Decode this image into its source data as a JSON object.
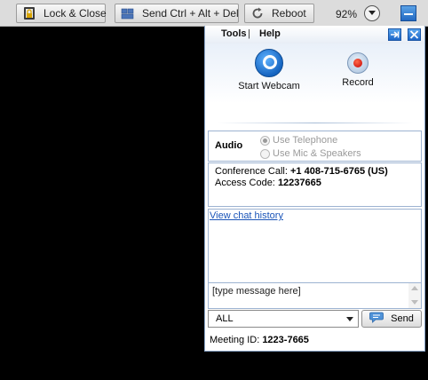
{
  "toolbar": {
    "lock_label": "Lock & Close",
    "cad_label": "Send Ctrl + Alt + Del",
    "reboot_label": "Reboot",
    "zoom": "92%",
    "icons": {
      "lock": "lock-icon",
      "cad": "keyboard-icon",
      "reboot": "reboot-icon",
      "zoom_dropdown": "chevron-down-icon",
      "minimize": "minimize-icon"
    }
  },
  "panel": {
    "menu": {
      "tools": "Tools",
      "separator": "|",
      "help": "Help"
    },
    "header_icons": {
      "popout": "popout-arrow-icon",
      "close": "close-icon"
    },
    "media": {
      "webcam_label": "Start Webcam",
      "record_label": "Record"
    },
    "audio": {
      "title": "Audio",
      "options": [
        {
          "label": "Use Telephone",
          "selected": true
        },
        {
          "label": "Use Mic & Speakers",
          "selected": false
        }
      ]
    },
    "conference": {
      "call_label": "Conference Call:",
      "call_number": "+1 408-715-6765 (US)",
      "access_label": "Access Code:",
      "access_code": "12237665"
    },
    "chat": {
      "history_link": "View chat history",
      "message_placeholder": "[type message here]",
      "recipient": "ALL",
      "send_label": "Send"
    },
    "meeting": {
      "label": "Meeting ID:",
      "id": "1223-7665"
    }
  },
  "colors": {
    "accent_blue": "#2369c2",
    "link_blue": "#1a54b8",
    "record_red": "#c40000",
    "background": "#000000"
  }
}
